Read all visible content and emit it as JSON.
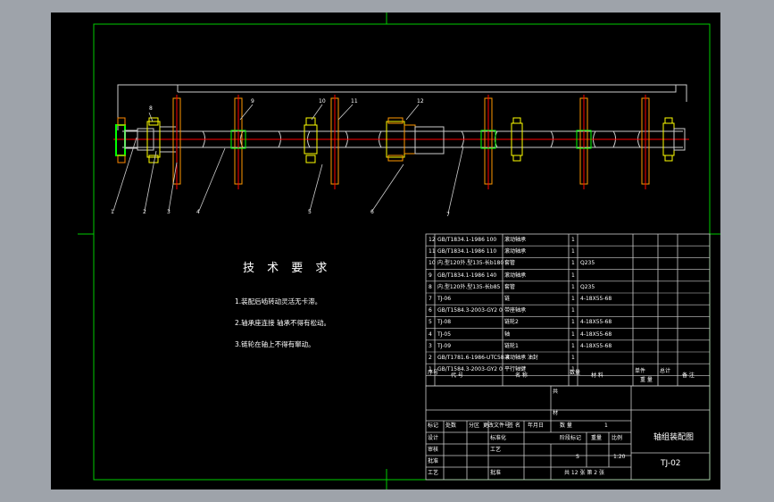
{
  "colors": {
    "background": "#9ea3aa",
    "paper": "#000000",
    "frame": "#00cc00",
    "text": "#ffffff",
    "centerline": "#ff0000",
    "part": "#ffff00",
    "border": "#cccccc"
  },
  "technical_requirements": {
    "title": "技 术 要 求",
    "notes": [
      "1.装配后啮转动灵活无卡滞。",
      "2.轴承座连接 轴承不得有松动。",
      "3.链轮在轴上不得有窜动。"
    ]
  },
  "callouts": [
    "1",
    "2",
    "3",
    "4",
    "5",
    "6",
    "7",
    "8",
    "9",
    "10",
    "11",
    "12"
  ],
  "bom": {
    "rows": [
      {
        "no": "12",
        "code": "GB/T1834.1-1986 100",
        "name": "滚动轴承",
        "qty": "1",
        "note": ""
      },
      {
        "no": "11",
        "code": "GB/T1834.1-1986 110",
        "name": "滚动轴承",
        "qty": "1",
        "note": ""
      },
      {
        "no": "10",
        "code": "内.型120外.型135-长b180",
        "name": "套管",
        "qty": "1",
        "note": "Q235"
      },
      {
        "no": "9",
        "code": "GB/T1834.1-1986 140",
        "name": "滚动轴承",
        "qty": "1",
        "note": ""
      },
      {
        "no": "8",
        "code": "内.型120外.型135-长b85",
        "name": "套管",
        "qty": "1",
        "note": "Q235"
      },
      {
        "no": "7",
        "code": "TJ-06",
        "name": "链",
        "qty": "1",
        "note": "4-18X55-68"
      },
      {
        "no": "6",
        "code": "GB/T1584.3-2003-GY2 0",
        "name": "带座轴承",
        "qty": "1",
        "note": ""
      },
      {
        "no": "5",
        "code": "TJ-08",
        "name": "链轮2",
        "qty": "1",
        "note": "4-18X55-68"
      },
      {
        "no": "4",
        "code": "TJ-05",
        "name": "轴",
        "qty": "1",
        "note": "4-18X55-68"
      },
      {
        "no": "3",
        "code": "TJ-09",
        "name": "链轮1",
        "qty": "1",
        "note": "4-18X55-68"
      },
      {
        "no": "2",
        "code": "GB/T1781.6-1986-UTC58-4",
        "name": "滚动轴承 油封",
        "qty": "1",
        "note": ""
      },
      {
        "no": "1",
        "code": "GB/T1584.3-2003-GY2 0",
        "name": "平行轴键",
        "qty": "1",
        "note": ""
      }
    ],
    "header": {
      "no": "序号",
      "code": "代   号",
      "name": "名   称",
      "qty": "数量",
      "material": "材   料",
      "unit": "单件",
      "total": "总计",
      "weight": "重   量",
      "remark": "备 注"
    }
  },
  "title_block": {
    "drawing_name": "轴组装配图",
    "drawing_code": "TJ-02",
    "scale": "1:20",
    "sheet": "共 12 张 第 2 张",
    "labels": {
      "mark": "标记",
      "count": "处数",
      "zone": "分区",
      "change_doc": "更改文件号",
      "sign": "签 名",
      "date": "年月日",
      "design": "设计",
      "standard": "标准化",
      "check": "审核",
      "process": "工艺",
      "approve": "批准",
      "stage": "阶段标记",
      "weight": "重量",
      "ratio": "比例",
      "stage_value": "S",
      "count_label": "数   量",
      "one": "1",
      "ji": "共",
      "zi": "材",
      "yu": "料"
    }
  }
}
